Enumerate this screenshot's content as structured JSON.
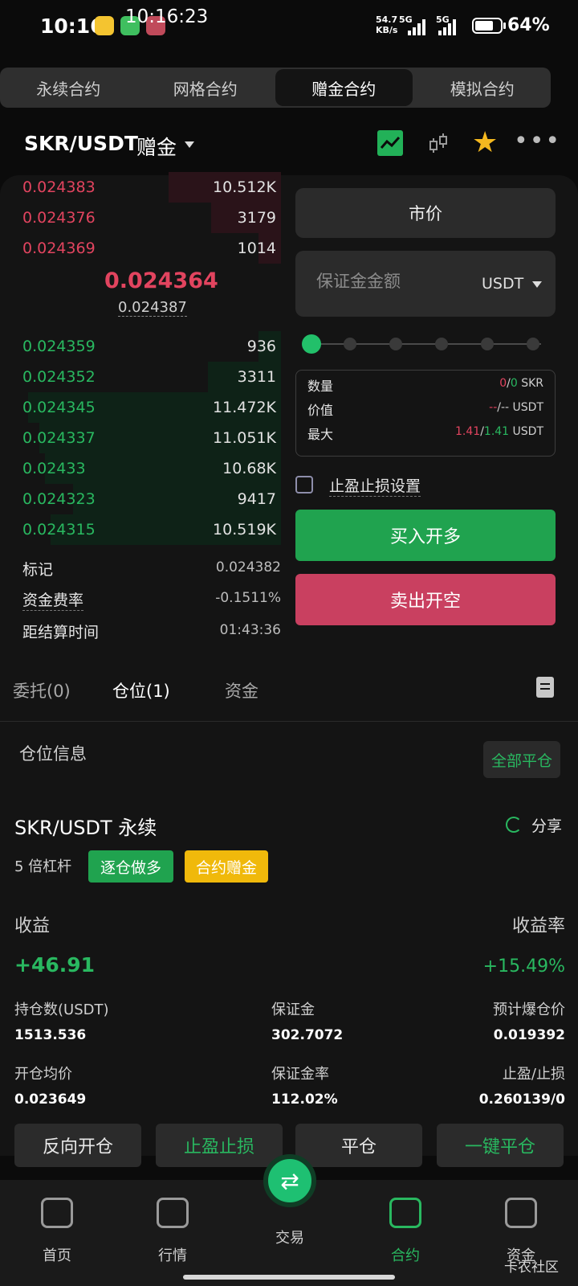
{
  "status_bar": {
    "time": "10:16",
    "overlay_time": "10:16:23",
    "net_speed": "54.7",
    "net_unit": "KB/s",
    "net_type_1": "5G",
    "net_type_2": "5G",
    "battery": "64%"
  },
  "contract_tabs": [
    "永续合约",
    "网格合约",
    "赠金合约",
    "模拟合约"
  ],
  "active_contract_tab": "赠金合约",
  "pair": {
    "symbol": "SKR/USDT",
    "tag": "赠金"
  },
  "orderbook": {
    "asks": [
      {
        "price": "0.024383",
        "qty": "10.512K",
        "depth": 0.4
      },
      {
        "price": "0.024376",
        "qty": "3179",
        "depth": 0.25
      },
      {
        "price": "0.024369",
        "qty": "1014",
        "depth": 0.08
      }
    ],
    "last_price": "0.024364",
    "mark_price": "0.024387",
    "bids": [
      {
        "price": "0.024359",
        "qty": "936",
        "depth": 0.08
      },
      {
        "price": "0.024352",
        "qty": "3311",
        "depth": 0.26
      },
      {
        "price": "0.024345",
        "qty": "11.472K",
        "depth": 0.9
      },
      {
        "price": "0.024337",
        "qty": "11.051K",
        "depth": 0.86
      },
      {
        "price": "0.02433",
        "qty": "10.68K",
        "depth": 0.84
      },
      {
        "price": "0.024323",
        "qty": "9417",
        "depth": 0.74
      },
      {
        "price": "0.024315",
        "qty": "10.519K",
        "depth": 0.82
      }
    ]
  },
  "market_info": {
    "mark_label": "标记",
    "mark_value": "0.024382",
    "funding_label": "资金费率",
    "funding_value": "-0.1511%",
    "settle_label": "距结算时间",
    "settle_value": "01:43:36"
  },
  "order_form": {
    "order_type": "市价",
    "amount_placeholder": "保证金金额",
    "amount_unit": "USDT",
    "slider_position": 0,
    "qty_label": "数量",
    "qty_a": "0",
    "qty_b": "0",
    "qty_unit": "SKR",
    "value_label": "价值",
    "value_a": "--",
    "value_b": "--",
    "value_unit": "USDT",
    "max_label": "最大",
    "max_a": "1.41",
    "max_b": "1.41",
    "max_unit": "USDT",
    "tpsl_label": "止盈止损设置",
    "buy_label": "买入开多",
    "sell_label": "卖出开空"
  },
  "sub_tabs": {
    "orders": "委托(0)",
    "positions": "仓位(1)",
    "assets": "资金"
  },
  "position": {
    "section_title": "仓位信息",
    "close_all": "全部平仓",
    "title": "SKR/USDT 永续",
    "share": "分享",
    "leverage": "5 倍杠杆",
    "badge_mode": "逐仓做多",
    "badge_bonus": "合约赠金",
    "pnl_label": "收益",
    "pnl_rate_label": "收益率",
    "pnl_value": "+46.91",
    "pnl_rate": "+15.49%",
    "size_label": "持仓数(USDT)",
    "size_value": "1513.536",
    "margin_label": "保证金",
    "margin_value": "302.7072",
    "liq_label": "预计爆仓价",
    "liq_value": "0.019392",
    "entry_label": "开仓均价",
    "entry_value": "0.023649",
    "margin_rate_label": "保证金率",
    "margin_rate_value": "112.02%",
    "tpsl_label": "止盈/止损",
    "tpsl_value": "0.260139/0",
    "actions": [
      "反向开仓",
      "止盈止损",
      "平仓",
      "一键平仓"
    ]
  },
  "bottom_nav": {
    "home": "首页",
    "market": "行情",
    "trade": "交易",
    "contract": "合约",
    "assets": "资金"
  },
  "watermark": "卡农社区",
  "colors": {
    "green": "#29b860",
    "red": "#e2445f",
    "gold": "#f0b90b"
  }
}
